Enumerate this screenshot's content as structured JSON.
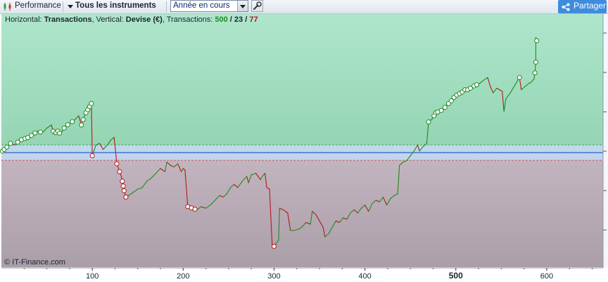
{
  "toolbar": {
    "performance_label": "Performance",
    "instruments_label": "Tous les instruments",
    "period_select_value": "Année en cours",
    "share_label": "Partager",
    "performance_icon": "candlestick-icon",
    "wrench_icon": "wrench-icon",
    "share_icon": "share-icon"
  },
  "info_bar": {
    "horizontal_label": "Horizontal: ",
    "horizontal_value": "Transactions",
    "vertical_label": ", Vertical: ",
    "vertical_value": "Devise (€)",
    "transactions_label": ", Transactions: ",
    "total": "500",
    "sep1": " / ",
    "winners": "23",
    "sep2": " / ",
    "losers": "77"
  },
  "credit": "© IT-Finance.com",
  "colors": {
    "gain_zone": "#a8e2c8",
    "loss_zone": "#bfb3bd",
    "band": "#c2d8f2",
    "zero_line": "#2d5fc7",
    "up_line": "#1e8a1e",
    "down_line": "#b51818"
  },
  "chart_data": {
    "type": "line",
    "xlabel": "",
    "ylabel": "",
    "title": "",
    "xlim": [
      0,
      662
    ],
    "x_ticks": [
      100,
      200,
      300,
      400,
      500,
      600
    ],
    "highlighted_tick": 500,
    "y_axis_labels_visible": false,
    "ylim_relative": [
      -1.0,
      1.0
    ],
    "zero_band_relative": [
      -0.07,
      0.07
    ],
    "legend": "none",
    "grid": false,
    "series": [
      {
        "points": [
          [
            1,
            0.01
          ],
          [
            5,
            0.03
          ],
          [
            10,
            0.06
          ],
          [
            15,
            0.05
          ],
          [
            20,
            0.08
          ],
          [
            25,
            0.09
          ],
          [
            30,
            0.1
          ],
          [
            35,
            0.12
          ],
          [
            40,
            0.14
          ],
          [
            45,
            0.13
          ],
          [
            50,
            0.16
          ],
          [
            55,
            0.18
          ],
          [
            58,
            0.12
          ],
          [
            62,
            0.14
          ],
          [
            65,
            0.12
          ],
          [
            70,
            0.17
          ],
          [
            75,
            0.19
          ],
          [
            80,
            0.21
          ],
          [
            85,
            0.24
          ],
          [
            88,
            0.18
          ],
          [
            92,
            0.25
          ],
          [
            95,
            0.28
          ],
          [
            97,
            0.3
          ],
          [
            99,
            0.32
          ],
          [
            100,
            -0.02
          ],
          [
            104,
            0.05
          ],
          [
            108,
            0.06
          ],
          [
            112,
            0.02
          ],
          [
            115,
            0.04
          ],
          [
            118,
            0.06
          ],
          [
            120,
            0.08
          ],
          [
            124,
            0.1
          ],
          [
            127,
            -0.07
          ],
          [
            130,
            -0.12
          ],
          [
            132,
            -0.15
          ],
          [
            135,
            -0.24
          ],
          [
            137,
            -0.28
          ],
          [
            140,
            -0.27
          ],
          [
            145,
            -0.25
          ],
          [
            150,
            -0.23
          ],
          [
            155,
            -0.22
          ],
          [
            160,
            -0.18
          ],
          [
            165,
            -0.16
          ],
          [
            170,
            -0.13
          ],
          [
            175,
            -0.1
          ],
          [
            180,
            -0.12
          ],
          [
            182,
            -0.06
          ],
          [
            186,
            -0.08
          ],
          [
            190,
            -0.09
          ],
          [
            194,
            -0.07
          ],
          [
            198,
            -0.12
          ],
          [
            200,
            -0.1
          ],
          [
            202,
            -0.11
          ],
          [
            205,
            -0.34
          ],
          [
            210,
            -0.35
          ],
          [
            215,
            -0.36
          ],
          [
            220,
            -0.34
          ],
          [
            225,
            -0.35
          ],
          [
            230,
            -0.33
          ],
          [
            235,
            -0.3
          ],
          [
            240,
            -0.27
          ],
          [
            244,
            -0.28
          ],
          [
            248,
            -0.26
          ],
          [
            252,
            -0.22
          ],
          [
            256,
            -0.2
          ],
          [
            260,
            -0.22
          ],
          [
            265,
            -0.18
          ],
          [
            270,
            -0.15
          ],
          [
            272,
            -0.19
          ],
          [
            275,
            -0.14
          ],
          [
            280,
            -0.13
          ],
          [
            285,
            -0.17
          ],
          [
            287,
            -0.15
          ],
          [
            290,
            -0.13
          ],
          [
            292,
            -0.22
          ],
          [
            295,
            -0.23
          ],
          [
            298,
            -0.59
          ],
          [
            300,
            -0.59
          ],
          [
            305,
            -0.55
          ],
          [
            306,
            -0.35
          ],
          [
            310,
            -0.36
          ],
          [
            315,
            -0.38
          ],
          [
            318,
            -0.49
          ],
          [
            322,
            -0.49
          ],
          [
            328,
            -0.48
          ],
          [
            332,
            -0.46
          ],
          [
            335,
            -0.44
          ],
          [
            340,
            -0.45
          ],
          [
            342,
            -0.37
          ],
          [
            346,
            -0.39
          ],
          [
            350,
            -0.43
          ],
          [
            354,
            -0.47
          ],
          [
            356,
            -0.53
          ],
          [
            360,
            -0.51
          ],
          [
            364,
            -0.47
          ],
          [
            368,
            -0.43
          ],
          [
            372,
            -0.44
          ],
          [
            376,
            -0.41
          ],
          [
            380,
            -0.42
          ],
          [
            384,
            -0.38
          ],
          [
            388,
            -0.36
          ],
          [
            392,
            -0.38
          ],
          [
            396,
            -0.35
          ],
          [
            400,
            -0.33
          ],
          [
            404,
            -0.37
          ],
          [
            408,
            -0.32
          ],
          [
            412,
            -0.3
          ],
          [
            416,
            -0.31
          ],
          [
            420,
            -0.28
          ],
          [
            424,
            -0.33
          ],
          [
            428,
            -0.29
          ],
          [
            432,
            -0.27
          ],
          [
            436,
            -0.26
          ],
          [
            438,
            -0.08
          ],
          [
            442,
            -0.06
          ],
          [
            446,
            -0.05
          ],
          [
            450,
            -0.02
          ],
          [
            455,
            0.02
          ],
          [
            458,
            0.05
          ],
          [
            460,
            0.01
          ],
          [
            464,
            0.04
          ],
          [
            468,
            0.06
          ],
          [
            470,
            0.2
          ],
          [
            474,
            0.22
          ],
          [
            478,
            0.26
          ],
          [
            482,
            0.27
          ],
          [
            486,
            0.28
          ],
          [
            490,
            0.31
          ],
          [
            494,
            0.33
          ],
          [
            498,
            0.36
          ],
          [
            502,
            0.38
          ],
          [
            506,
            0.39
          ],
          [
            510,
            0.41
          ],
          [
            514,
            0.41
          ],
          [
            518,
            0.43
          ],
          [
            522,
            0.44
          ],
          [
            526,
            0.45
          ],
          [
            530,
            0.47
          ],
          [
            535,
            0.49
          ],
          [
            538,
            0.43
          ],
          [
            541,
            0.39
          ],
          [
            545,
            0.42
          ],
          [
            548,
            0.41
          ],
          [
            551,
            0.4
          ],
          [
            553,
            0.27
          ],
          [
            555,
            0.35
          ],
          [
            560,
            0.39
          ],
          [
            565,
            0.44
          ],
          [
            570,
            0.49
          ],
          [
            572,
            0.41
          ],
          [
            576,
            0.43
          ],
          [
            580,
            0.45
          ],
          [
            583,
            0.46
          ],
          [
            586,
            0.48
          ],
          [
            587,
            0.52
          ],
          [
            588,
            0.59
          ],
          [
            588,
            0.75
          ],
          [
            589,
            0.73
          ],
          [
            590,
            0.73
          ]
        ],
        "trade_markers_x": [
          1,
          3,
          6,
          10,
          18,
          22,
          26,
          29,
          33,
          37,
          43,
          57,
          60,
          62,
          64,
          69,
          73,
          78,
          88,
          90,
          93,
          95,
          97,
          99,
          100,
          127,
          130,
          133,
          134,
          135,
          137,
          205,
          209,
          213,
          300,
          470,
          476,
          478,
          480,
          484,
          488,
          492,
          495,
          498,
          501,
          504,
          507,
          510,
          513,
          516,
          520,
          523,
          570,
          587,
          588,
          589
        ]
      }
    ]
  }
}
